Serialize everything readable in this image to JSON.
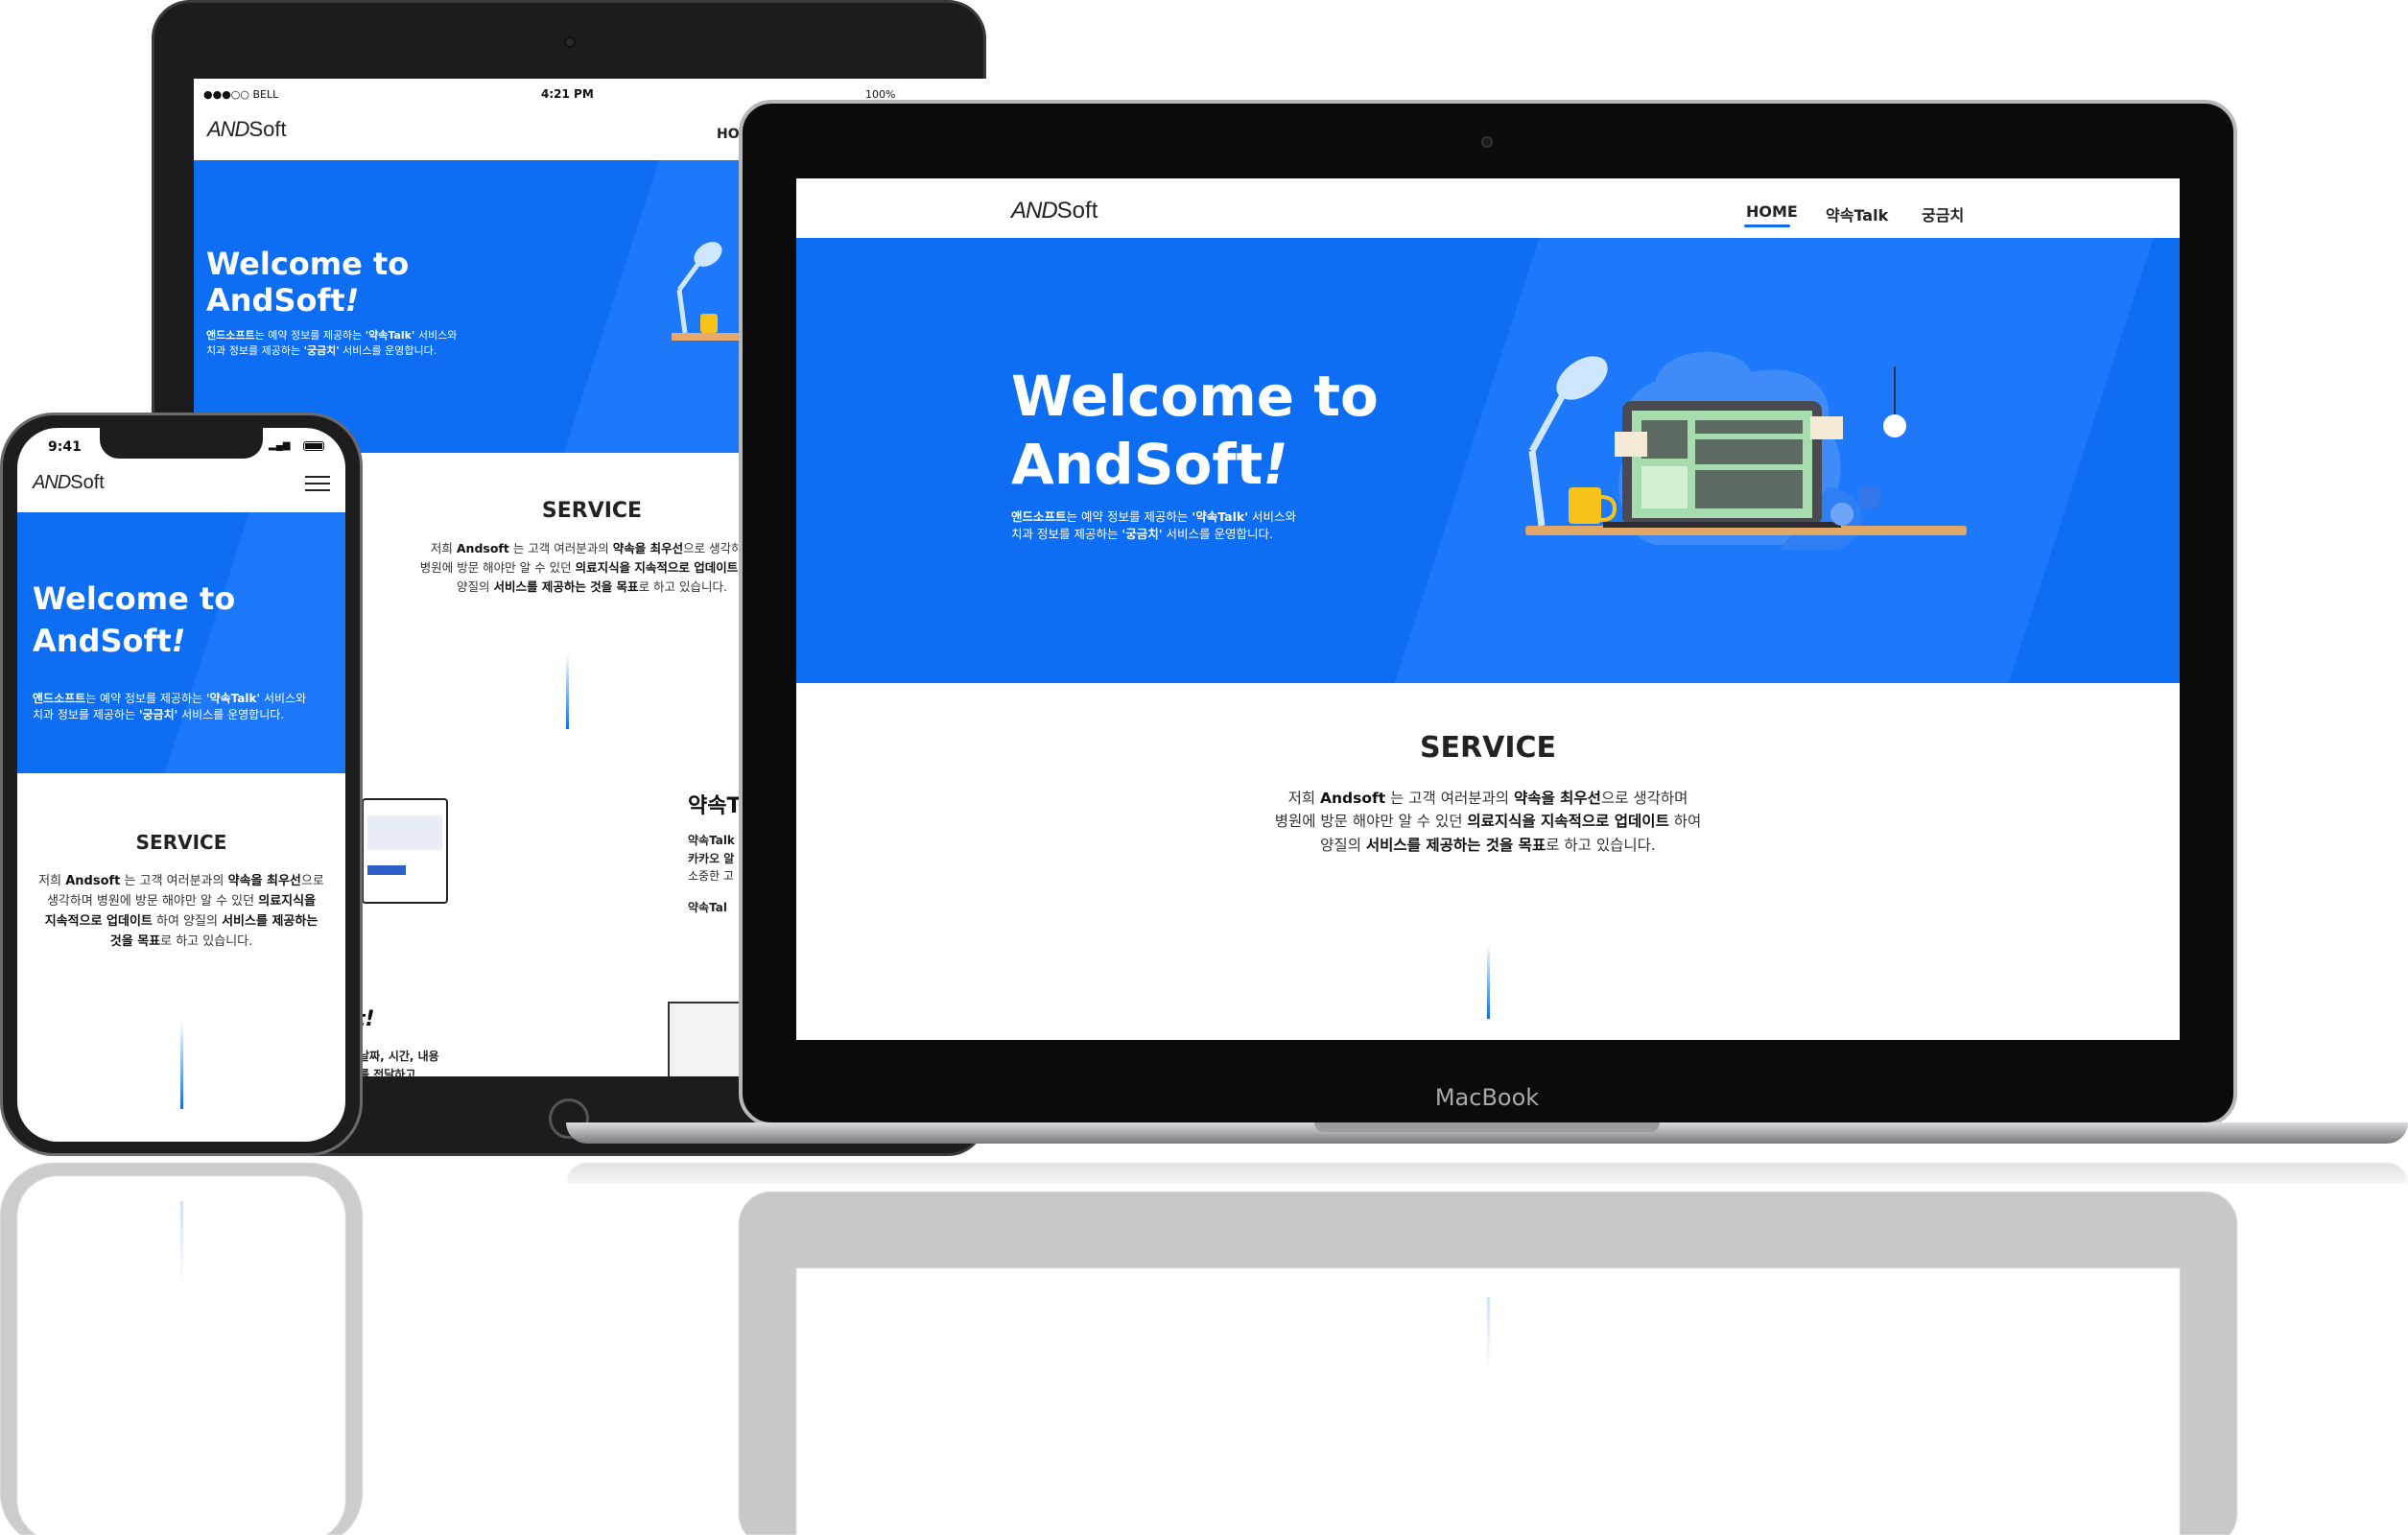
{
  "brand": {
    "logo_and": "AND",
    "logo_soft": "Soft"
  },
  "nav": {
    "items": [
      "HOME",
      "약속Talk",
      "궁금치"
    ],
    "active": 0
  },
  "hero": {
    "title_line1": "Welcome to",
    "title_line2": "AndSoft",
    "title_mark": "!",
    "desc": [
      [
        {
          "t": "앤드소프트",
          "b": true
        },
        {
          "t": "는 예약 정보를 제공하는 ",
          "b": false
        },
        {
          "t": "'약속Talk'",
          "b": true
        },
        {
          "t": " 서비스와",
          "b": false
        }
      ],
      [
        {
          "t": "치과 정보를 제공하는 ",
          "b": false
        },
        {
          "t": "'궁금치'",
          "b": true
        },
        {
          "t": " 서비스를 운영합니다.",
          "b": false
        }
      ]
    ]
  },
  "service": {
    "heading": "SERVICE",
    "lines": [
      [
        {
          "t": "저희 ",
          "b": false
        },
        {
          "t": "Andsoft",
          "b": true
        },
        {
          "t": " 는 고객 여러분과의 ",
          "b": false
        },
        {
          "t": "약속을 최우선",
          "b": true
        },
        {
          "t": "으로 생각하며",
          "b": false
        }
      ],
      [
        {
          "t": "병원에 방문 해야만 알 수 있던 ",
          "b": false
        },
        {
          "t": "의료지식을 지속적으로 업데이트",
          "b": true
        },
        {
          "t": " 하여",
          "b": false
        }
      ],
      [
        {
          "t": "양질의 ",
          "b": false
        },
        {
          "t": "서비스를 제공하는 것을 목표",
          "b": true
        },
        {
          "t": "로 하고 있습니다.",
          "b": false
        }
      ]
    ],
    "phone_lines": [
      [
        {
          "t": "저희 ",
          "b": false
        },
        {
          "t": "Andsoft",
          "b": true
        },
        {
          "t": " 는 고객 여러분과의 ",
          "b": false
        },
        {
          "t": "약속을 최우선",
          "b": true
        },
        {
          "t": "으로",
          "b": false
        }
      ],
      [
        {
          "t": "생각하며 병원에 방문 해야만 알 수 있던 ",
          "b": false
        },
        {
          "t": "의료지식을",
          "b": true
        }
      ],
      [
        {
          "t": "지속적으로 업데이트",
          "b": true
        },
        {
          "t": " 하여 양질의 ",
          "b": false
        },
        {
          "t": "서비스를 제공하는",
          "b": true
        }
      ],
      [
        {
          "t": "것을 목표",
          "b": true
        },
        {
          "t": "로 하고 있습니다.",
          "b": false
        }
      ]
    ]
  },
  "tablet": {
    "status": {
      "carrier": "●●●○○ BELL",
      "time": "4:21 PM",
      "battery": "100%"
    },
    "nav_partial": "HOM",
    "partial_section_title": "약속T",
    "partial_lines": [
      "약속Talk",
      "카카오 알",
      "소중한 고",
      "약속Tal"
    ],
    "partial_excl": "t!",
    "partial_bottom": [
      "날짜, 시간, 내용",
      "를 전달하고"
    ]
  },
  "phone": {
    "status_time": "9:41"
  },
  "laptop": {
    "brand_label": "MacBook"
  },
  "colors": {
    "hero_blue": "#0d6ef3",
    "text_dark": "#222222"
  },
  "icons": [
    "menu-icon",
    "desk-lamp-icon",
    "laptop-illustration",
    "coffee-mug-icon",
    "spider-icon",
    "wifi-icon",
    "battery-icon",
    "signal-icon"
  ]
}
